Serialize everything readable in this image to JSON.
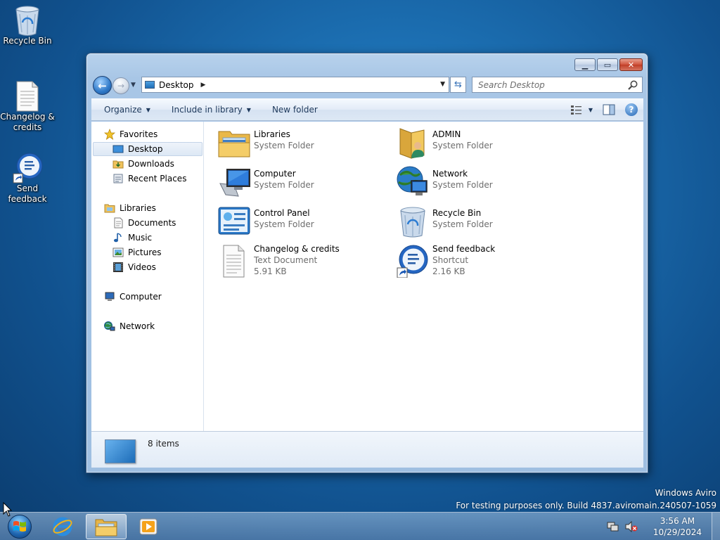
{
  "desktop": {
    "icons": [
      {
        "label": "Recycle Bin",
        "icon": "recycle-bin-icon"
      },
      {
        "label": "Changelog & credits",
        "icon": "text-document-icon"
      },
      {
        "label": "Send feedback",
        "icon": "feedback-shortcut-icon"
      }
    ]
  },
  "window": {
    "caption_buttons": {
      "minimize": "minimize",
      "maximize": "maximize",
      "close": "close"
    },
    "address": {
      "crumb": "Desktop"
    },
    "search": {
      "placeholder": "Search Desktop"
    },
    "toolbar": {
      "organize": "Organize",
      "include_in_library": "Include in library",
      "new_folder": "New folder"
    },
    "nav": {
      "favorites": "Favorites",
      "desktop": "Desktop",
      "downloads": "Downloads",
      "recent_places": "Recent Places",
      "libraries": "Libraries",
      "documents": "Documents",
      "music": "Music",
      "pictures": "Pictures",
      "videos": "Videos",
      "computer": "Computer",
      "network": "Network"
    },
    "items": [
      {
        "name": "Libraries",
        "type": "System Folder",
        "size": "",
        "icon": "libraries-icon"
      },
      {
        "name": "ADMIN",
        "type": "System Folder",
        "size": "",
        "icon": "user-folder-icon"
      },
      {
        "name": "Computer",
        "type": "System Folder",
        "size": "",
        "icon": "computer-icon"
      },
      {
        "name": "Network",
        "type": "System Folder",
        "size": "",
        "icon": "network-icon"
      },
      {
        "name": "Control Panel",
        "type": "System Folder",
        "size": "",
        "icon": "control-panel-icon"
      },
      {
        "name": "Recycle Bin",
        "type": "System Folder",
        "size": "",
        "icon": "recycle-bin-icon"
      },
      {
        "name": "Changelog & credits",
        "type": "Text Document",
        "size": "5.91 KB",
        "icon": "text-document-icon"
      },
      {
        "name": "Send feedback",
        "type": "Shortcut",
        "size": "2.16 KB",
        "icon": "feedback-shortcut-icon"
      }
    ],
    "details": {
      "count": "8 items"
    }
  },
  "watermark": {
    "line1": "Windows Aviro",
    "line2": "For testing purposes only. Build 4837.aviromain.240507-1059"
  },
  "taskbar": {
    "time": "3:56 AM",
    "date": "10/29/2024"
  }
}
